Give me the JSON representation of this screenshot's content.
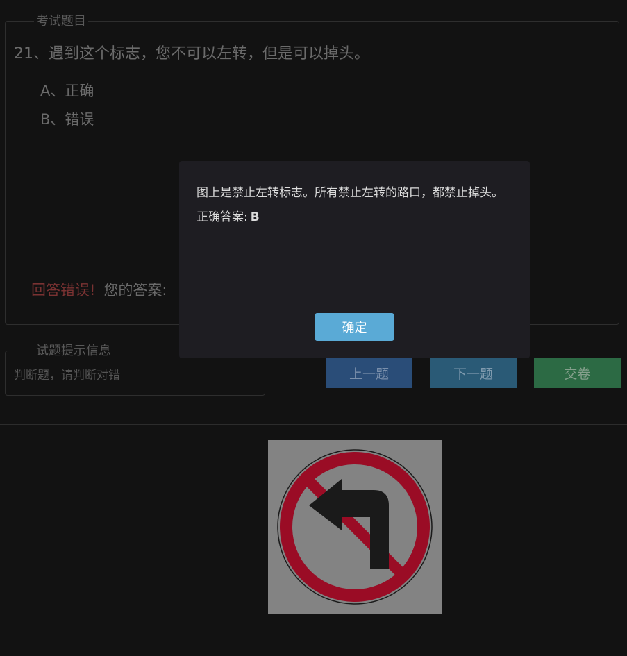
{
  "question_panel": {
    "legend": "考试题目",
    "question": "21、遇到这个标志，您不可以左转，但是可以掉头。",
    "options": [
      {
        "label": "A、正确"
      },
      {
        "label": "B、错误"
      }
    ],
    "result_status": "回答错误!",
    "your_answer_label": "您的答案:"
  },
  "hint_panel": {
    "legend": "试题提示信息",
    "text": "判断题，请判断对错"
  },
  "nav": {
    "prev_label": "上一题",
    "next_label": "下一题",
    "submit_label": "交卷"
  },
  "sign_image": {
    "icon": "no-left-turn-sign-icon",
    "colors": {
      "ring": "#9a0c25",
      "arrow": "#1a1a1a",
      "background": "#838383"
    }
  },
  "modal": {
    "explanation": "图上是禁止左转标志。所有禁止左转的路口，都禁止掉头。",
    "answer_label": "正确答案:",
    "answer_value": "B",
    "ok_label": "确定"
  },
  "colors": {
    "page_bg": "#121212",
    "modal_bg": "#1e1d22",
    "ok_button": "#5aaad6",
    "prev_button": "#2a4d78",
    "next_button": "#2a5a76",
    "submit_button": "#2c6a44",
    "wrong_text": "#7a3232"
  }
}
